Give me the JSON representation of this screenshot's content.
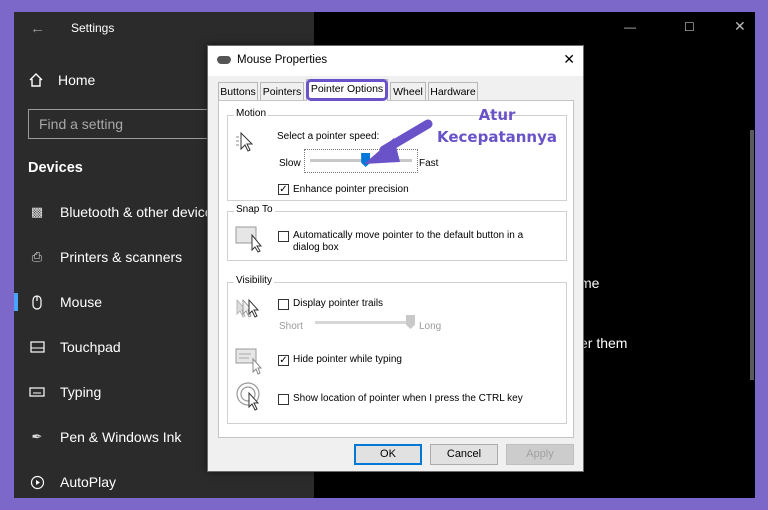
{
  "settings": {
    "window_title": "Settings",
    "back_icon": "back-arrow-icon",
    "home_label": "Home",
    "search_placeholder": "Find a setting",
    "section": "Devices",
    "nav": [
      {
        "label": "Bluetooth & other devices",
        "icon": "bluetooth-icon"
      },
      {
        "label": "Printers & scanners",
        "icon": "printer-icon"
      },
      {
        "label": "Mouse",
        "icon": "mouse-icon",
        "selected": true
      },
      {
        "label": "Touchpad",
        "icon": "touchpad-icon"
      },
      {
        "label": "Typing",
        "icon": "keyboard-icon"
      },
      {
        "label": "Pen & Windows Ink",
        "icon": "pen-icon"
      },
      {
        "label": "AutoPlay",
        "icon": "autoplay-icon"
      }
    ],
    "bg_fragments": [
      "me",
      "er them"
    ]
  },
  "dialog": {
    "title": "Mouse Properties",
    "tabs": [
      "Buttons",
      "Pointers",
      "Pointer Options",
      "Wheel",
      "Hardware"
    ],
    "active_tab": "Pointer Options",
    "motion": {
      "group": "Motion",
      "speed_label": "Select a pointer speed:",
      "slow": "Slow",
      "fast": "Fast",
      "speed_fraction": 0.55,
      "enhance_label": "Enhance pointer precision",
      "enhance_checked": true
    },
    "snap": {
      "group": "Snap To",
      "label_line1": "Automatically move pointer to the default button in a",
      "label_line2": "dialog box",
      "checked": false
    },
    "visibility": {
      "group": "Visibility",
      "trails_label": "Display pointer trails",
      "trails_checked": false,
      "short": "Short",
      "long": "Long",
      "trails_fraction": 1.0,
      "hide_label": "Hide pointer while typing",
      "hide_checked": true,
      "ctrl_label": "Show location of pointer when I press the CTRL key",
      "ctrl_checked": false
    },
    "buttons": {
      "ok": "OK",
      "cancel": "Cancel",
      "apply": "Apply"
    }
  },
  "annotation": {
    "line1": "Atur",
    "line2": "Kecepatannya",
    "color": "#6a52c9"
  }
}
